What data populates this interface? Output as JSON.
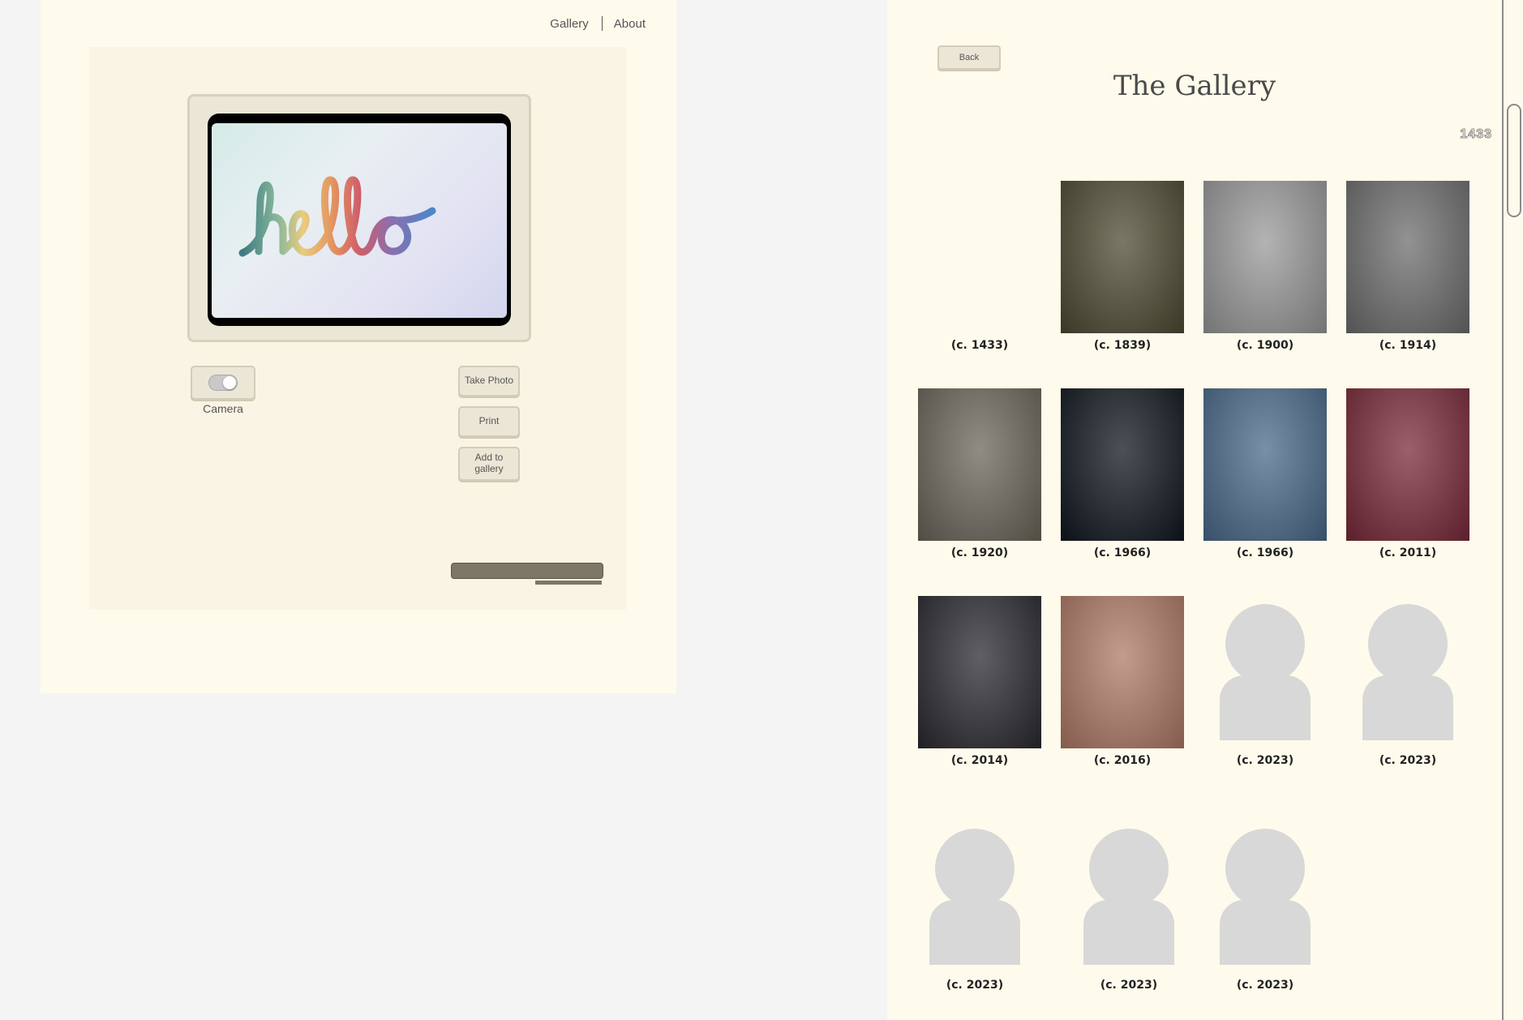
{
  "nav": {
    "gallery": "Gallery",
    "about": "About"
  },
  "camera": {
    "label": "Camera",
    "on": true
  },
  "screen": {
    "text": "hello"
  },
  "buttons": {
    "take_photo": "Take Photo",
    "print": "Print",
    "add_to_gallery": "Add to gallery"
  },
  "gallery": {
    "back": "Back",
    "title": "The Gallery",
    "year_badge": "1433",
    "items": [
      {
        "caption": "(c. 1433)",
        "kind": "blank"
      },
      {
        "caption": "(c. 1839)",
        "kind": "photo",
        "tone": "#4f4a33"
      },
      {
        "caption": "(c. 1900)",
        "kind": "photo",
        "tone": "#9a9a9a"
      },
      {
        "caption": "(c. 1914)",
        "kind": "photo",
        "tone": "#6e6e6e"
      },
      {
        "caption": "(c. 1920)",
        "kind": "photo",
        "tone": "#6b665a"
      },
      {
        "caption": "(c. 1966)",
        "kind": "photo",
        "tone": "#10161f"
      },
      {
        "caption": "(c. 1966)",
        "kind": "photo",
        "tone": "#4a6a8a"
      },
      {
        "caption": "(c. 2011)",
        "kind": "photo",
        "tone": "#7a2a3a"
      },
      {
        "caption": "(c. 2014)",
        "kind": "photo",
        "tone": "#2a2a30"
      },
      {
        "caption": "(c. 2016)",
        "kind": "photo",
        "tone": "#b07a66"
      },
      {
        "caption": "(c. 2023)",
        "kind": "placeholder"
      },
      {
        "caption": "(c. 2023)",
        "kind": "placeholder"
      },
      {
        "caption": "(c. 2023)",
        "kind": "placeholder"
      },
      {
        "caption": "(c. 2023)",
        "kind": "placeholder"
      },
      {
        "caption": "(c. 2023)",
        "kind": "placeholder"
      }
    ]
  }
}
